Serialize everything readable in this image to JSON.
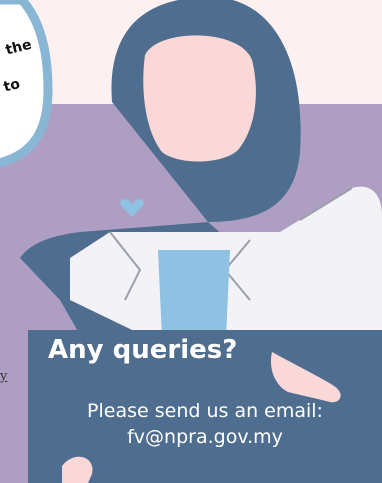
{
  "bubble": {
    "line1": "the",
    "line2": "to"
  },
  "left_fragment": "y",
  "sign": {
    "heading": "Any queries?",
    "line1": "Please send us an email:",
    "line2": "fv@npra.gov.my"
  },
  "colors": {
    "background_pink": "#fcf0f1",
    "panel_purple": "#ae9fc2",
    "hijab_blue": "#4f6e8f",
    "face_pink": "#fbd8d8",
    "heart_blue": "#8fc1e2",
    "coat_white": "#f3f2f7",
    "bubble_border": "#8ab6d6"
  }
}
